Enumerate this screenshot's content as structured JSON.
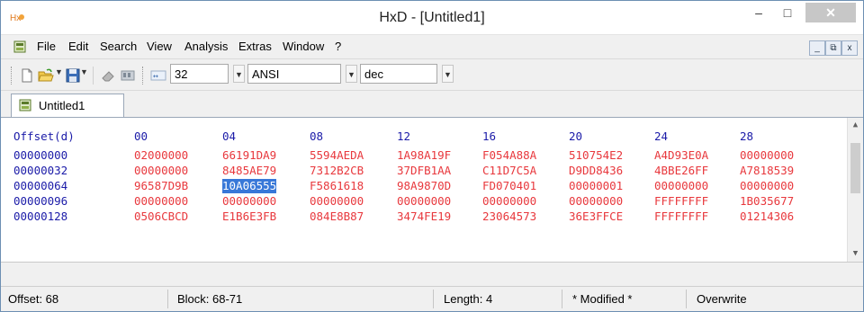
{
  "window": {
    "title": "HxD - [Untitled1]",
    "min_glyph": "–",
    "max_glyph": "□",
    "close_glyph": "✕"
  },
  "menu": [
    {
      "label": "File"
    },
    {
      "label": "Edit"
    },
    {
      "label": "Search"
    },
    {
      "label": "View"
    },
    {
      "label": "Analysis"
    },
    {
      "label": "Extras"
    },
    {
      "label": "Window"
    },
    {
      "label": "?"
    }
  ],
  "mdi_buttons": {
    "minimize": "_",
    "restore": "⧉",
    "close": "x"
  },
  "toolbar": {
    "bytes_per_row": "32",
    "charset": "ANSI",
    "offset_base": "dec",
    "icons": [
      "new-file-icon",
      "open-folder-icon",
      "save-icon",
      "eraser-icon",
      "ram-icon",
      "bytes-per-row-icon"
    ]
  },
  "tab": {
    "label": "Untitled1"
  },
  "editor": {
    "offset_header": "Offset(d)",
    "column_headers": [
      "00",
      "04",
      "08",
      "12",
      "16",
      "20",
      "24",
      "28"
    ],
    "rows": [
      {
        "offset": "00000000",
        "groups": [
          "02000000",
          "66191DA9",
          "5594AEDA",
          "1A98A19F",
          "F054A88A",
          "510754E2",
          "A4D93E0A",
          "00000000"
        ]
      },
      {
        "offset": "00000032",
        "groups": [
          "00000000",
          "8485AE79",
          "7312B2CB",
          "37DFB1AA",
          "C11D7C5A",
          "D9DD8436",
          "4BBE26FF",
          "A7818539"
        ]
      },
      {
        "offset": "00000064",
        "groups": [
          "96587D9B",
          "10A06555",
          "F5861618",
          "98A9870D",
          "FD070401",
          "00000001",
          "00000000",
          "00000000"
        ]
      },
      {
        "offset": "00000096",
        "groups": [
          "00000000",
          "00000000",
          "00000000",
          "00000000",
          "00000000",
          "00000000",
          "FFFFFFFF",
          "1B035677"
        ]
      },
      {
        "offset": "00000128",
        "groups": [
          "0506CBCD",
          "E1B6E3FB",
          "084E8B87",
          "3474FE19",
          "23064573",
          "36E3FFCE",
          "FFFFFFFF",
          "01214306"
        ]
      }
    ],
    "selected": {
      "row": 2,
      "group": 1
    },
    "colors": {
      "offset": "#1b1ba8",
      "data": "#e8383d",
      "selection": "#3878d8"
    }
  },
  "status": {
    "offset": "Offset: 68",
    "block": "Block: 68-71",
    "length": "Length: 4",
    "modified": "* Modified *",
    "mode": "Overwrite"
  }
}
